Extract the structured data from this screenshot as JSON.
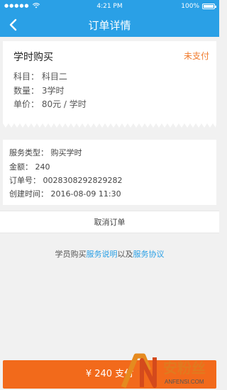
{
  "status_bar": {
    "carrier_dots": "●●●●●",
    "time": "4:21 PM",
    "battery_percent": "100%"
  },
  "navbar": {
    "title": "订单详情",
    "back_icon": "chevron-left-icon"
  },
  "order_card": {
    "type": "学时购买",
    "status": "未支付",
    "subject": "科目：  科目二",
    "quantity": "数量：  3学时",
    "unit_price": "单价：  80元 / 学时"
  },
  "detail_card": {
    "service_type": "服务类型：  购买学时",
    "amount": "金额：  240",
    "order_no": "订单号：  0028308292829282",
    "created_time": "创建时间：  2016-08-09   11:30"
  },
  "cancel_label": "取消订单",
  "notice": {
    "prefix": "学员购买",
    "link1": "服务说明",
    "middle": "以及",
    "link2": "服务协议"
  },
  "pay_button": "¥ 240  支付",
  "watermark": {
    "logo_text": "安粉丝",
    "sub_text": "ANFENSI.COM"
  },
  "colors": {
    "brand_blue": "#2aa0e6",
    "status_orange": "#f07b2d",
    "pay_orange": "#f26a1b"
  }
}
